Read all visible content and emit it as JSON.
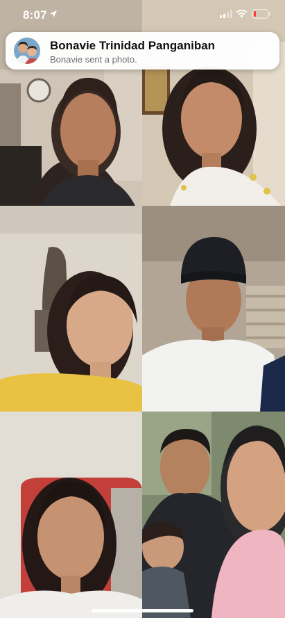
{
  "status_bar": {
    "time": "8:07",
    "location_icon": "location-arrow-icon",
    "signal_icon": "cellular-signal-icon",
    "wifi_icon": "wifi-icon",
    "battery_icon": "battery-low-icon",
    "battery_color": "#ff3b30"
  },
  "notification": {
    "sender": "Bonavie Trinidad Panganiban",
    "message": "Bonavie sent a photo.",
    "avatar_icon": "group-avatar"
  },
  "video_grid": {
    "participant_count": 6,
    "tiles": [
      {
        "position": "top-left"
      },
      {
        "position": "top-right"
      },
      {
        "position": "middle-left"
      },
      {
        "position": "middle-right"
      },
      {
        "position": "bottom-left"
      },
      {
        "position": "bottom-right"
      }
    ]
  },
  "home_indicator": "home-indicator-bar"
}
